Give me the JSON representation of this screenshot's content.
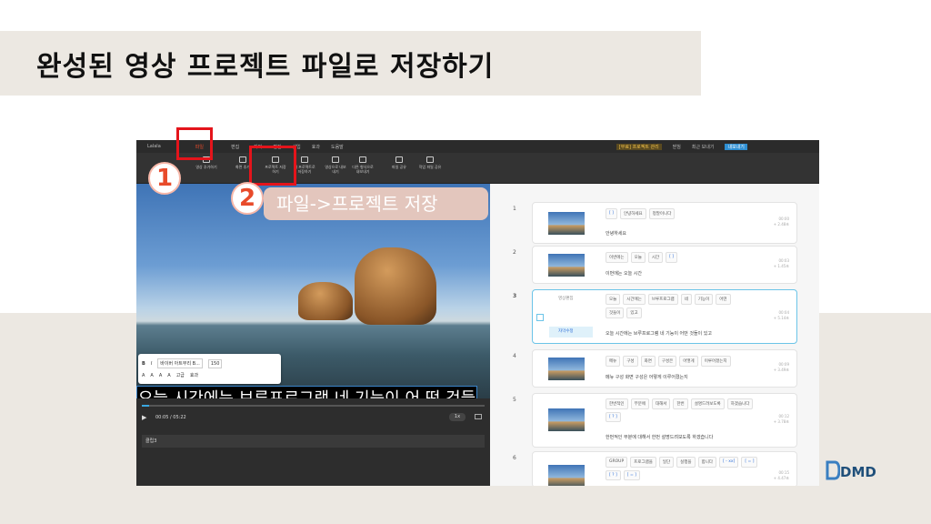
{
  "title": "완성된 영상 프로젝트 파일로 저장하기",
  "callout": "파일->프로젝트 저장",
  "badges": [
    "1",
    "2"
  ],
  "menubar": {
    "items": [
      "Lalala",
      "파일",
      "편집",
      "자막",
      "편집",
      "삽입",
      "효과",
      "도움말"
    ],
    "right": [
      "[무료] 프로젝트 관리",
      "받침",
      "최근 보내기",
      "내보내기"
    ]
  },
  "toolbar": {
    "items": [
      "영상 추가하기",
      "화면 추가",
      "프로젝트 저장하기",
      "새 프로젝트로 저장하기",
      "영상으로 내보내기",
      "다른 형식으로 내보내기",
      "파일 공유",
      "작업 파일 공유"
    ]
  },
  "subtitle": "오늘 시간에는 브루프로그램 네 기능이 어 떤 것들이 있고",
  "format_bar": {
    "font": "바이버 아트부리 B...",
    "size": "150",
    "buttons": [
      "B",
      "I",
      "A",
      "A",
      "A",
      "A"
    ],
    "extra": [
      "고급",
      "효과"
    ]
  },
  "player": {
    "time": "00:05 / 05:22",
    "speed": "1x",
    "clip_label": "클립3",
    "progress_fraction": 0.02
  },
  "cards": [
    {
      "num": "1",
      "chips": [
        "[ ]",
        "안녕하세요",
        "정말이니다"
      ],
      "sentence": "안녕하세요",
      "time": "00:00",
      "dur": "+ 2.48초"
    },
    {
      "num": "2",
      "chips": [
        "이번에는",
        "오늘",
        "시간",
        "[ ]"
      ],
      "sentence": "이번에는 오늘 시간",
      "time": "00:03",
      "dur": "+ 1.45초"
    },
    {
      "num": "3",
      "chips": [
        "오늘",
        "시간에는",
        "브루프로그램",
        "네",
        "기능이",
        "어떤",
        "것들이",
        "있고"
      ],
      "sentence": "오늘 시간에는 브루프로그램 네 기능이 어떤 것들이 있고",
      "labels": [
        "영상편집",
        "자막수정"
      ],
      "time": "00:04",
      "dur": "+ 5.14초"
    },
    {
      "num": "4",
      "chips": [
        "메뉴",
        "구성",
        "화면",
        "구성은",
        "어떻게",
        "이루어졌는지"
      ],
      "sentence": "메뉴 구성 화면 구성은 어떻게 이루어졌는지",
      "time": "00:09",
      "dur": "+ 3.49초"
    },
    {
      "num": "5",
      "chips": [
        "한번적인",
        "부분에",
        "대해서",
        "한번",
        "설명드려보도록",
        "하겠습니다",
        "[ ? ]"
      ],
      "sentence": "한번적인 부분에 대해서 한번 설명드려보도록 하겠습니다",
      "time": "00:12",
      "dur": "+ 3.78초"
    },
    {
      "num": "6",
      "chips": [
        "GROUP",
        "프로그램을",
        "일단",
        "실행을",
        "합니다",
        "[ - xx]",
        "[ = ]",
        "[ ? ]",
        "[ = ]"
      ],
      "sentence": "",
      "time": "00:15",
      "dur": "+ 4.47초"
    }
  ],
  "logo": "DMD",
  "colors": {
    "accent_red": "#e4141b",
    "callout_bg": "#e3c6bd",
    "band": "#ece8e2",
    "selection": "#6bc4e8"
  }
}
